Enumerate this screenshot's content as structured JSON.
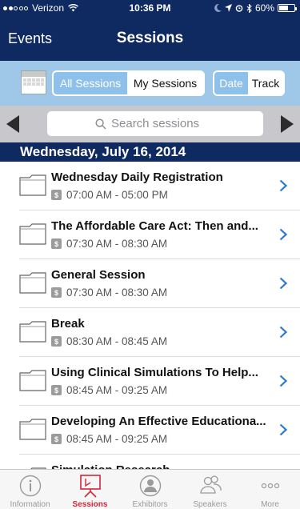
{
  "status_bar": {
    "carrier": "Verizon",
    "time": "10:36 PM",
    "battery": "60%",
    "battery_level": 0.6
  },
  "nav": {
    "back_label": "Events",
    "title": "Sessions"
  },
  "filters": {
    "segment_sessions": [
      "All Sessions",
      "My Sessions"
    ],
    "segment_sort": [
      "Date",
      "Track"
    ]
  },
  "search": {
    "placeholder": "Search sessions"
  },
  "date_header": "Wednesday, July 16, 2014",
  "sessions": [
    {
      "title": "Wednesday Daily Registration",
      "time": "07:00 AM - 05:00 PM"
    },
    {
      "title": "The Affordable Care Act: Then and...",
      "time": "07:30 AM - 08:30 AM"
    },
    {
      "title": "General Session",
      "time": "07:30 AM - 08:30 AM"
    },
    {
      "title": "Break",
      "time": "08:30 AM - 08:45 AM"
    },
    {
      "title": "Using Clinical Simulations To Help...",
      "time": "08:45 AM - 09:25 AM"
    },
    {
      "title": "Developing An Effective Educationa...",
      "time": "08:45 AM - 09:25 AM"
    },
    {
      "title": "Simulation Research",
      "time": ""
    }
  ],
  "tabs": [
    {
      "label": "Information",
      "icon": "info-icon"
    },
    {
      "label": "Sessions",
      "icon": "presentation-icon"
    },
    {
      "label": "Exhibitors",
      "icon": "person-icon"
    },
    {
      "label": "Speakers",
      "icon": "people-icon"
    },
    {
      "label": "More",
      "icon": "more-icon"
    }
  ],
  "colors": {
    "navy": "#0f2a60",
    "light_blue": "#9fc8e8",
    "accent": "#d5253a",
    "chevron": "#2a7ad4"
  }
}
